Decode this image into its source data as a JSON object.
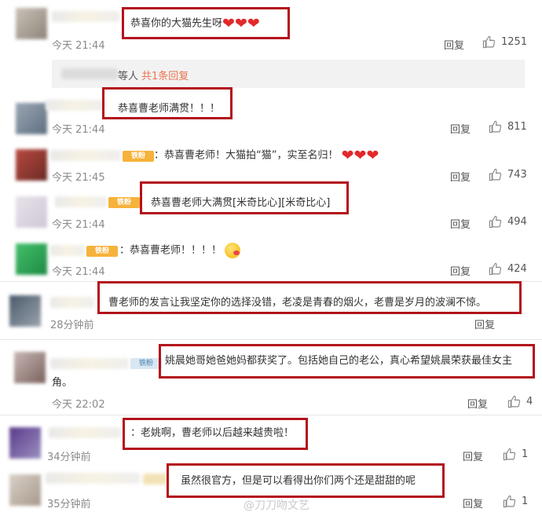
{
  "comments": [
    {
      "text": "恭喜你的大猫先生呀",
      "time": "今天 21:44",
      "reply_label": "回复",
      "likes": "1251",
      "sub_reply": {
        "text": "等人",
        "link": "共1条回复"
      }
    },
    {
      "text": "恭喜曹老师满贯！！！",
      "time": "今天 21:44",
      "reply_label": "回复",
      "likes": "811"
    },
    {
      "text": "：恭喜曹老师！大猫拍“猫”，实至名归！",
      "time": "今天 21:45",
      "reply_label": "回复",
      "likes": "743",
      "fan_badge": "铁粉"
    },
    {
      "text": "恭喜曹老师大满贯[米奇比心][米奇比心]",
      "time": "今天 21:44",
      "reply_label": "回复",
      "likes": "494",
      "fan_badge": "铁粉"
    },
    {
      "text": "：恭喜曹老师！！！！",
      "time": "今天 21:44",
      "reply_label": "回复",
      "likes": "424",
      "fan_badge": "铁粉"
    },
    {
      "text": "曹老师的发言让我坚定你的选择没错，老凌是青春的烟火，老曹是岁月的波澜不惊。",
      "time": "28分钟前",
      "reply_label": "回复"
    },
    {
      "text": "姚晨她哥她爸她妈都获奖了。包括她自己的老公，真心希望姚晨荣获最佳女主",
      "text_line2": "角。",
      "time": "今天 22:02",
      "reply_label": "回复",
      "likes": "4",
      "fan_badge": "铁粉"
    },
    {
      "text": "：老姚啊，曹老师以后越来越贵啦！",
      "time": "34分钟前",
      "reply_label": "回复",
      "likes": "1"
    },
    {
      "text": "虽然很官方，但是可以看得出你们两个还是甜甜的呢",
      "time": "35分钟前",
      "reply_label": "回复",
      "likes": "1"
    }
  ],
  "watermark": "@刀刀吻文艺",
  "colors": {
    "highlight_border": "#b3121b",
    "heart": "#e3282b",
    "badge": "#f6b23a"
  },
  "icons": {
    "like": "thumbs-up-icon",
    "heart": "heart-icon",
    "emoji": "kiss-face-emoji"
  }
}
